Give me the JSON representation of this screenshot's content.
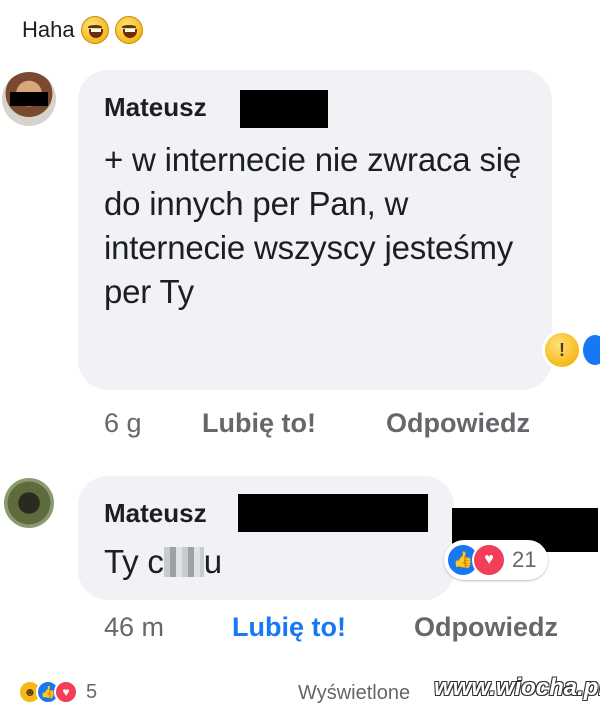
{
  "post": {
    "text": "Haha",
    "emojis": [
      "haha-emoji",
      "haha-emoji"
    ]
  },
  "comments": [
    {
      "author": "Mateusz",
      "text": "+ w internecie nie zwraca się do innych per Pan, w internecie wszyscy jesteśmy per Ty",
      "reactions": [
        "wow",
        "like"
      ],
      "time": "6 g",
      "like_label": "Lubię to!",
      "reply_label": "Odpowiedz"
    },
    {
      "author": "Mateusz",
      "text_before": "Ty c",
      "text_after": "u",
      "reactions": [
        "like",
        "love"
      ],
      "reaction_count": "21",
      "time": "46 m",
      "like_label": "Lubię to!",
      "reply_label": "Odpowiedz"
    }
  ],
  "footer": {
    "reactions": [
      "haha",
      "like",
      "love"
    ],
    "reaction_count": "5",
    "seen_text": "Wyświetlone",
    "watermark": "www.wiocha.pl"
  },
  "colors": {
    "bubble": "#f0f2f5",
    "like_blue": "#1877f2",
    "love_red": "#f33e58",
    "meta_gray": "#65676b"
  }
}
